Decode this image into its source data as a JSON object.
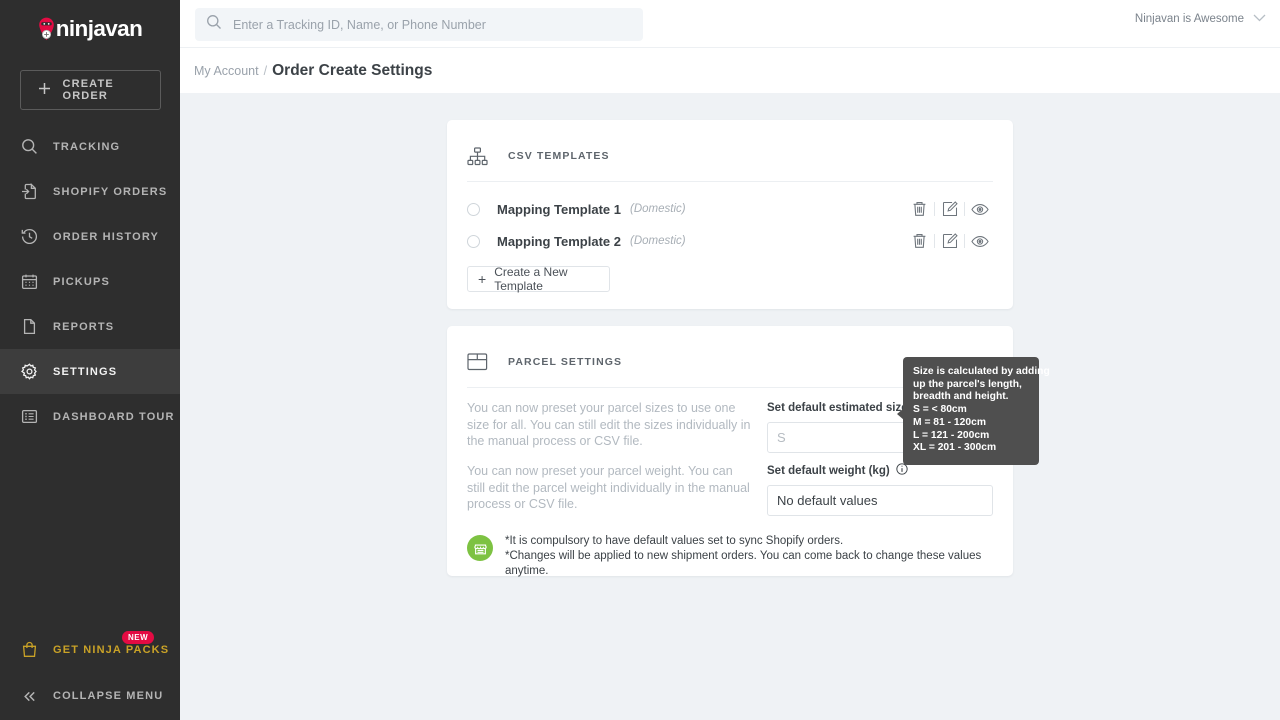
{
  "brand": {
    "logo_text": "ninjavan",
    "logo_icon": "ninja-pin-icon",
    "accent_red": "#e30b43",
    "gold": "#c9a227",
    "green": "#7dc242",
    "sidebar_bg": "#2e2e2e",
    "page_bg": "#eff2f5"
  },
  "sidebar": {
    "create_order_label": "CREATE ORDER",
    "items": [
      {
        "label": "TRACKING",
        "icon": "search-icon",
        "active": false
      },
      {
        "label": "SHOPIFY ORDERS",
        "icon": "file-import-icon",
        "active": false
      },
      {
        "label": "ORDER HISTORY",
        "icon": "history-clock-icon",
        "active": false
      },
      {
        "label": "PICKUPS",
        "icon": "calendar-icon",
        "active": false
      },
      {
        "label": "REPORTS",
        "icon": "document-icon",
        "active": false
      },
      {
        "label": "SETTINGS",
        "icon": "gear-icon",
        "active": true
      },
      {
        "label": "DASHBOARD TOUR",
        "icon": "list-board-icon",
        "active": false
      }
    ],
    "ninja_packs_label": "GET NINJA PACKS",
    "ninja_packs_badge": "NEW",
    "collapse_label": "COLLAPSE MENU"
  },
  "topbar": {
    "search_placeholder": "Enter a Tracking ID, Name, or Phone Number",
    "search_value": "",
    "user_label": "Ninjavan  is Awesome"
  },
  "breadcrumb": {
    "parent": "My Account",
    "separator": "/",
    "current": "Order Create Settings"
  },
  "csv_card": {
    "title": "CSV TEMPLATES",
    "icon": "sitemap-icon",
    "templates": [
      {
        "name": "Mapping Template 1",
        "tag": "(Domestic)",
        "selected": false
      },
      {
        "name": "Mapping Template 2",
        "tag": "(Domestic)",
        "selected": false
      }
    ],
    "row_actions": [
      "trash-icon",
      "edit-icon",
      "eye-icon"
    ],
    "create_button_label": "Create a New Template",
    "create_button_plus": "+"
  },
  "parcel_card": {
    "title": "PARCEL SETTINGS",
    "icon": "parcel-box-icon",
    "size_desc": "You can now preset your parcel sizes to use one size for all. You can still edit the sizes individually in the manual process or CSV file.",
    "size_label": "Set default estimated size",
    "size_value": "S",
    "weight_desc": "You can now preset your parcel weight. You can still edit the parcel weight individually in the manual process or CSV file.",
    "weight_label": "Set default weight (kg)",
    "weight_value": "No default values",
    "note_line_1": "*It is compulsory to have default values set to sync Shopify orders.",
    "note_line_2": "*Changes will be applied to new shipment orders. You can come back to change these values anytime.",
    "note_icon": "shop-badge-icon"
  },
  "tooltip": {
    "lines": [
      "Size is calculated by adding",
      "up the parcel's length,",
      "breadth and height.",
      "S = < 80cm",
      "M = 81 - 120cm",
      "L = 121 - 200cm",
      "XL = 201 - 300cm"
    ]
  }
}
